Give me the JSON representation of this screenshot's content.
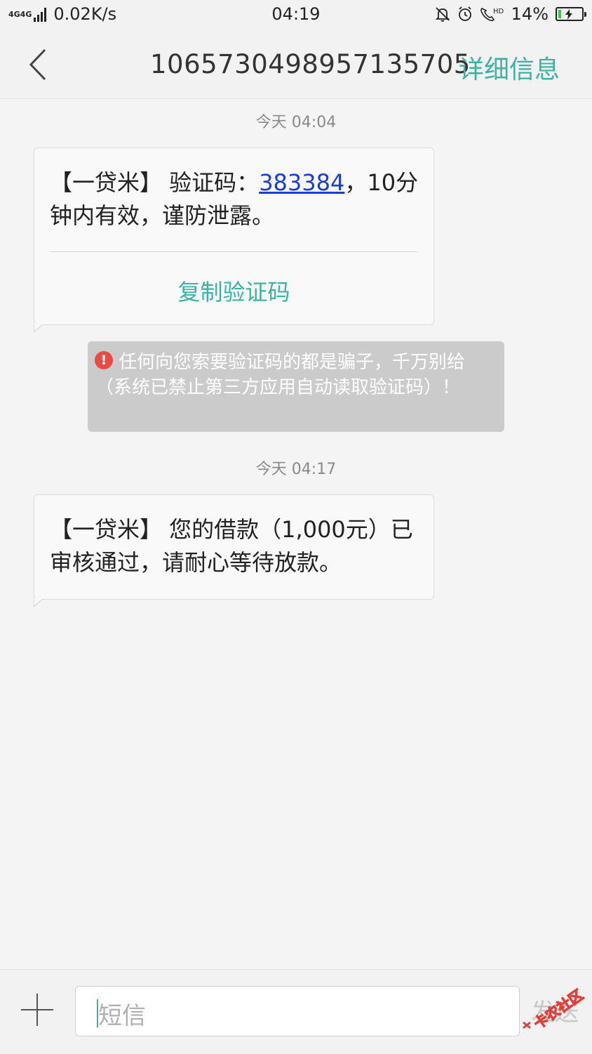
{
  "status_bar": {
    "network": "4G4G",
    "speed": "0.02K/s",
    "time": "04:19",
    "battery_percent": "14%",
    "battery_level": 0.14,
    "hd_label": "HD"
  },
  "header": {
    "back_icon": "chevron-left-icon",
    "title": "1065730498957135705",
    "detail_label": "详细信息"
  },
  "messages": [
    {
      "timestamp": "今天 04:04",
      "text_prefix": "【一贷米】 验证码：",
      "code": "383384",
      "text_suffix": "，10分钟内有效，谨防泄露。",
      "action_label": "复制验证码"
    },
    {
      "timestamp": "今天 04:17",
      "text": "【一贷米】 您的借款（1,000元）已审核通过，请耐心等待放款。"
    }
  ],
  "warning": {
    "icon": "!",
    "text": "任何向您索要验证码的都是骗子，千万别给（系统已禁止第三方应用自动读取验证码）！"
  },
  "input_bar": {
    "placeholder": "短信",
    "send_label": "发送",
    "watermark_text": "卡农社区"
  },
  "colors": {
    "accent": "#3ab3a2",
    "link": "#1a3dd4",
    "warning_bg": "#cbcbcb",
    "warning_icon": "#e94a44"
  }
}
